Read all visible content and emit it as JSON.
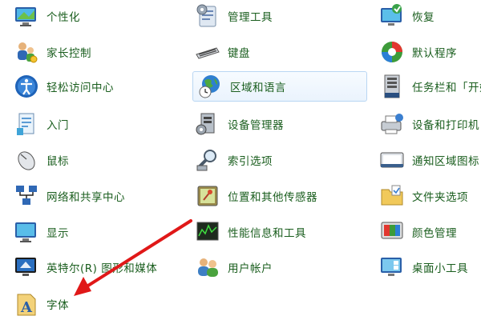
{
  "control_panel": {
    "items": [
      {
        "label": "个性化",
        "icon": "personalization-icon"
      },
      {
        "label": "管理工具",
        "icon": "admin-tools-icon"
      },
      {
        "label": "恢复",
        "icon": "recovery-icon"
      },
      {
        "label": "家长控制",
        "icon": "parental-controls-icon"
      },
      {
        "label": "键盘",
        "icon": "keyboard-icon"
      },
      {
        "label": "默认程序",
        "icon": "default-programs-icon"
      },
      {
        "label": "轻松访问中心",
        "icon": "ease-of-access-icon"
      },
      {
        "label": "区域和语言",
        "icon": "region-language-icon"
      },
      {
        "label": "任务栏和「开始",
        "icon": "taskbar-start-icon"
      },
      {
        "label": "入门",
        "icon": "getting-started-icon"
      },
      {
        "label": "设备管理器",
        "icon": "device-manager-icon"
      },
      {
        "label": "设备和打印机",
        "icon": "devices-printers-icon"
      },
      {
        "label": "鼠标",
        "icon": "mouse-icon"
      },
      {
        "label": "索引选项",
        "icon": "indexing-options-icon"
      },
      {
        "label": "通知区域图标",
        "icon": "notification-area-icon"
      },
      {
        "label": "网络和共享中心",
        "icon": "network-sharing-icon"
      },
      {
        "label": "位置和其他传感器",
        "icon": "location-sensors-icon"
      },
      {
        "label": "文件夹选项",
        "icon": "folder-options-icon"
      },
      {
        "label": "显示",
        "icon": "display-icon"
      },
      {
        "label": "性能信息和工具",
        "icon": "performance-icon"
      },
      {
        "label": "颜色管理",
        "icon": "color-management-icon"
      },
      {
        "label": "英特尔(R) 图形和媒体",
        "icon": "intel-graphics-icon"
      },
      {
        "label": "用户帐户",
        "icon": "user-accounts-icon"
      },
      {
        "label": "桌面小工具",
        "icon": "desktop-gadgets-icon"
      },
      {
        "label": "字体",
        "icon": "fonts-icon"
      }
    ],
    "highlighted_item": "区域和语言"
  },
  "annotation": {
    "arrow_color": "#e01818",
    "target": "字体"
  }
}
